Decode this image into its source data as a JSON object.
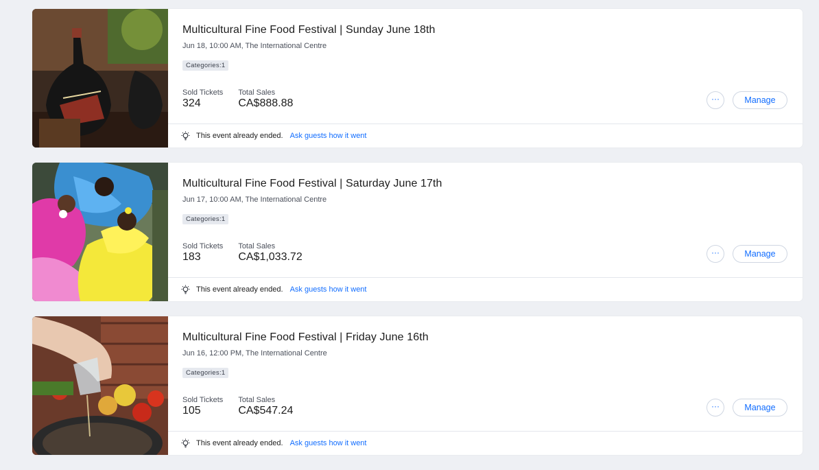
{
  "events": [
    {
      "title": "Multicultural Fine Food Festival | Sunday June 18th",
      "meta": "Jun 18, 10:00 AM, The International Centre",
      "badge": "Categories:1",
      "sold_label": "Sold Tickets",
      "sold_value": "324",
      "sales_label": "Total Sales",
      "sales_value": "CA$888.88",
      "more_label": "···",
      "manage_label": "Manage",
      "ended_text": "This event already ended.",
      "ask_link": "Ask guests how it went",
      "image": "coffee-pot-photo"
    },
    {
      "title": "Multicultural Fine Food Festival | Saturday June 17th",
      "meta": "Jun 17, 10:00 AM, The International Centre",
      "badge": "Categories:1",
      "sold_label": "Sold Tickets",
      "sold_value": "183",
      "sales_label": "Total Sales",
      "sales_value": "CA$1,033.72",
      "more_label": "···",
      "manage_label": "Manage",
      "ended_text": "This event already ended.",
      "ask_link": "Ask guests how it went",
      "image": "dancers-photo"
    },
    {
      "title": "Multicultural Fine Food Festival | Friday June 16th",
      "meta": "Jun 16, 12:00 PM, The International Centre",
      "badge": "Categories:1",
      "sold_label": "Sold Tickets",
      "sold_value": "105",
      "sales_label": "Total Sales",
      "sales_value": "CA$547.24",
      "more_label": "···",
      "manage_label": "Manage",
      "ended_text": "This event already ended.",
      "ask_link": "Ask guests how it went",
      "image": "cooking-oil-photo"
    }
  ],
  "colors": {
    "accent": "#116dff",
    "background": "#eef0f4",
    "badge_bg": "#e6e9ef"
  }
}
